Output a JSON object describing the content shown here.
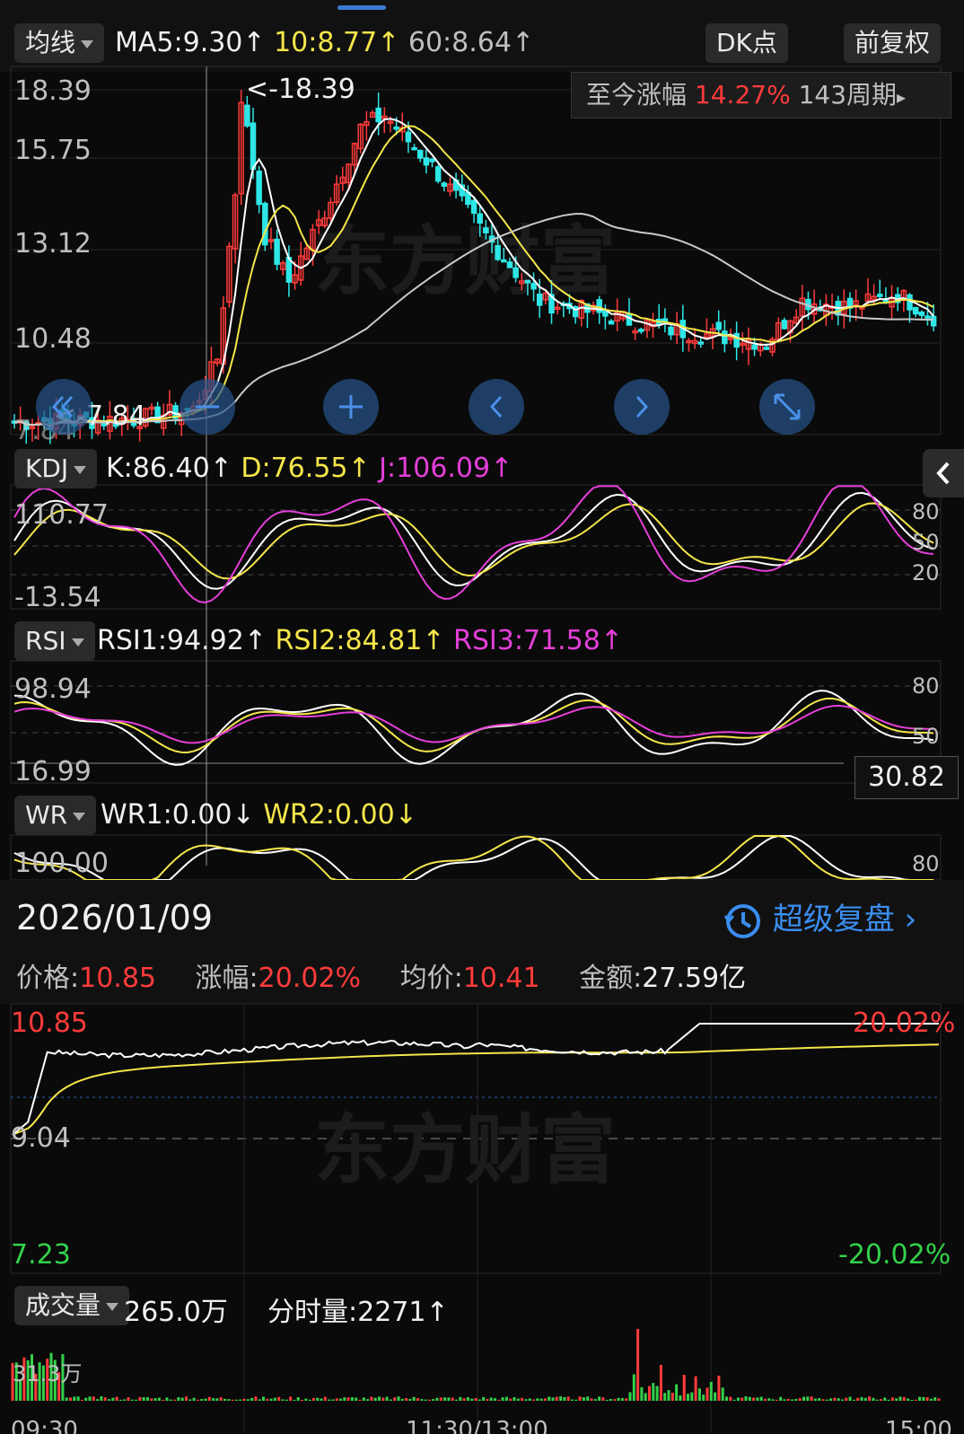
{
  "toolbar": {
    "ma_selector": "均线",
    "ma5": "MA5:9.30",
    "ma10": "10:8.77",
    "ma60": "60:8.64",
    "arrow_up": "↑",
    "arrow_down": "↓",
    "dk_button": "DK点",
    "fq_button": "前复权"
  },
  "kline": {
    "y_labels": [
      "18.39",
      "15.75",
      "13.12",
      "10.48",
      "7.84"
    ],
    "max_marker": "<-18.39",
    "min_marker": "<-7.84",
    "info_label": "至今涨幅",
    "info_pct": "14.27%",
    "info_period": "143周期"
  },
  "kdj": {
    "selector": "KDJ",
    "k": "K:86.40",
    "d": "D:76.55",
    "j": "J:106.09",
    "y_top": "110.77",
    "y_bottom": "-13.54",
    "right_labels": [
      "80",
      "50",
      "20"
    ]
  },
  "rsi": {
    "selector": "RSI",
    "rsi1": "RSI1:94.92",
    "rsi2": "RSI2:84.81",
    "rsi3": "RSI3:71.58",
    "y_top": "98.94",
    "y_bottom": "16.99",
    "right_labels": [
      "80",
      "50"
    ],
    "cursor_value": "30.82"
  },
  "wr": {
    "selector": "WR",
    "wr1": "WR1:0.00",
    "wr2": "WR2:0.00",
    "y_top": "100.00",
    "right_label": "80"
  },
  "intraday": {
    "date": "2026/01/09",
    "super_review": "超级复盘",
    "price_label": "价格:",
    "price_value": "10.85",
    "change_label": "涨幅:",
    "change_value": "20.02%",
    "avg_label": "均价:",
    "avg_value": "10.41",
    "amount_label": "金额:",
    "amount_value": "27.59亿",
    "y_top": "10.85",
    "y_mid": "9.04",
    "y_bottom": "7.23",
    "pct_top": "20.02%",
    "pct_bottom": "-20.02%"
  },
  "volume": {
    "selector": "成交量",
    "total": "265.0万",
    "minute_label": "分时量:2271",
    "y_top": "31.3万",
    "time_labels": [
      "09:30",
      "11:30/13:00",
      "15:00"
    ]
  },
  "colors": {
    "up": "#ff3b3b",
    "down": "#2ee6e6",
    "ma5": "#ffffff",
    "ma10": "#f5e64a",
    "ma60": "#c8c8c8",
    "magenta": "#e53fd9"
  },
  "chart_data": {
    "type": "candlestick",
    "indicators": [
      "MA5",
      "MA10",
      "MA60",
      "KDJ",
      "RSI",
      "WR"
    ],
    "ylim": [
      7.84,
      18.39
    ],
    "max_high": 18.39,
    "min_low": 7.84,
    "intraday": {
      "type": "line",
      "ylim": [
        7.23,
        10.85
      ],
      "prev_close": 9.04,
      "last_price": 10.85,
      "avg_price": 10.41
    }
  }
}
